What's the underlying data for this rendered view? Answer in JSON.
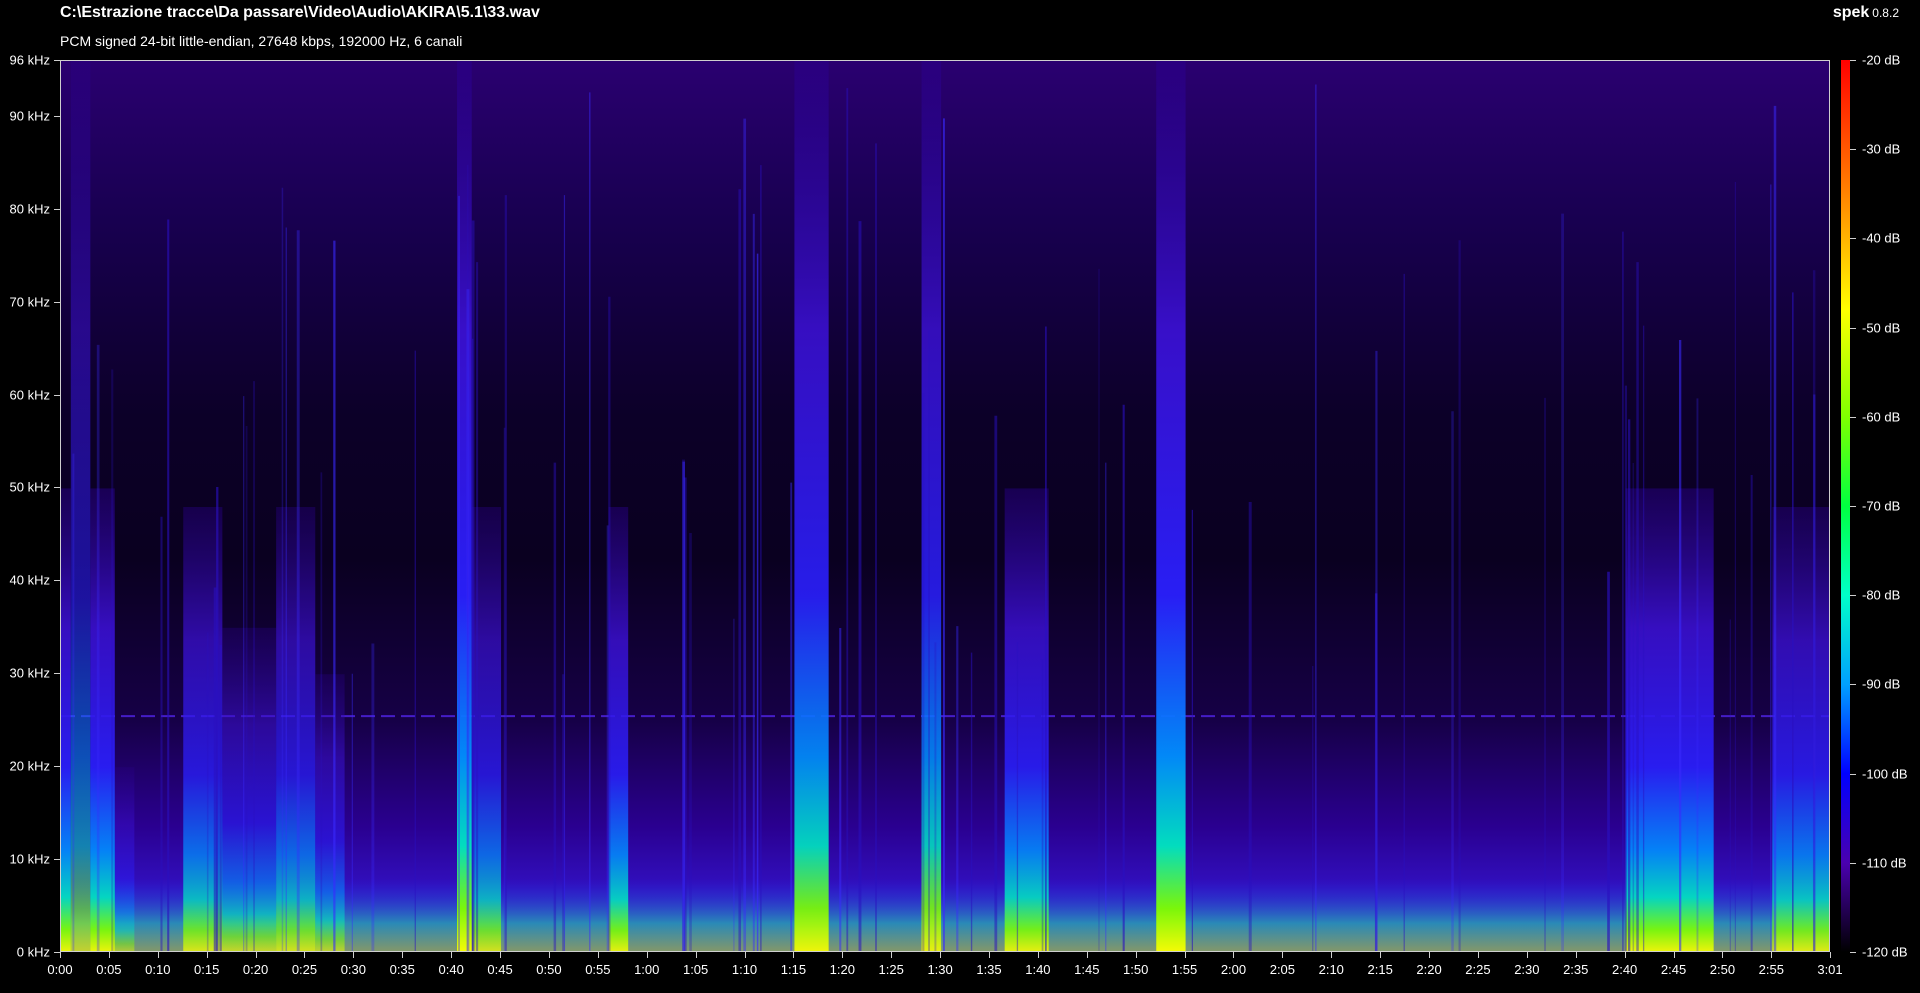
{
  "window": {
    "file_path": "C:\\Estrazione tracce\\Da passare\\Video\\Audio\\AKIRA\\5.1\\33.wav",
    "file_info": "PCM signed 24-bit little-endian, 27648 kbps, 192000 Hz, 6 canali",
    "app_name": "spek",
    "app_version": "0.8.2"
  },
  "frequency_axis": {
    "unit": "kHz",
    "max_label": "96 kHz",
    "labels": [
      "0 kHz",
      "10 kHz",
      "20 kHz",
      "30 kHz",
      "40 kHz",
      "50 kHz",
      "60 kHz",
      "70 kHz",
      "80 kHz",
      "90 kHz",
      "96 kHz"
    ],
    "values": [
      0,
      10,
      20,
      30,
      40,
      50,
      60,
      70,
      80,
      90,
      96
    ]
  },
  "time_axis": {
    "labels": [
      "0:00",
      "0:05",
      "0:10",
      "0:15",
      "0:20",
      "0:25",
      "0:30",
      "0:35",
      "0:40",
      "0:45",
      "0:50",
      "0:55",
      "1:00",
      "1:05",
      "1:10",
      "1:15",
      "1:20",
      "1:25",
      "1:30",
      "1:35",
      "1:40",
      "1:45",
      "1:50",
      "1:55",
      "2:00",
      "2:05",
      "2:10",
      "2:15",
      "2:20",
      "2:25",
      "2:30",
      "2:35",
      "2:40",
      "2:45",
      "2:50",
      "2:55",
      "3:01"
    ],
    "seconds": [
      0,
      5,
      10,
      15,
      20,
      25,
      30,
      35,
      40,
      45,
      50,
      55,
      60,
      65,
      70,
      75,
      80,
      85,
      90,
      95,
      100,
      105,
      110,
      115,
      120,
      125,
      130,
      135,
      140,
      145,
      150,
      155,
      160,
      165,
      170,
      175,
      181
    ],
    "duration_seconds": 181
  },
  "level_scale": {
    "labels": [
      "-20 dB",
      "-30 dB",
      "-40 dB",
      "-50 dB",
      "-60 dB",
      "-70 dB",
      "-80 dB",
      "-90 dB",
      "-100 dB",
      "-110 dB",
      "-120 dB"
    ],
    "values": [
      -20,
      -30,
      -40,
      -50,
      -60,
      -70,
      -80,
      -90,
      -100,
      -110,
      -120
    ],
    "colors": [
      "#ff0000",
      "#ff7a00",
      "#ffff00",
      "#7fff00",
      "#00ff40",
      "#00ffc8",
      "#00a0ff",
      "#0000ff",
      "#4a00b0",
      "#1a0040",
      "#000000"
    ]
  },
  "spectrogram": {
    "background_color": "#0a0020",
    "energy_bursts": [
      {
        "start": 0.0,
        "end": 1.0,
        "top_khz": 50,
        "strength": 0.9
      },
      {
        "start": 1.0,
        "end": 3.0,
        "top_khz": 96,
        "strength": 0.55
      },
      {
        "start": 3.0,
        "end": 5.5,
        "top_khz": 50,
        "strength": 0.9
      },
      {
        "start": 5.5,
        "end": 7.5,
        "top_khz": 20,
        "strength": 0.45
      },
      {
        "start": 12.5,
        "end": 16.5,
        "top_khz": 48,
        "strength": 0.75
      },
      {
        "start": 16.5,
        "end": 22.0,
        "top_khz": 35,
        "strength": 0.6
      },
      {
        "start": 22.0,
        "end": 26.0,
        "top_khz": 48,
        "strength": 0.7
      },
      {
        "start": 26.0,
        "end": 29.0,
        "top_khz": 30,
        "strength": 0.55
      },
      {
        "start": 40.5,
        "end": 42.0,
        "top_khz": 96,
        "strength": 0.95
      },
      {
        "start": 42.0,
        "end": 45.0,
        "top_khz": 48,
        "strength": 0.7
      },
      {
        "start": 56.0,
        "end": 58.0,
        "top_khz": 48,
        "strength": 0.85
      },
      {
        "start": 75.0,
        "end": 78.5,
        "top_khz": 96,
        "strength": 0.9
      },
      {
        "start": 88.0,
        "end": 90.0,
        "top_khz": 96,
        "strength": 0.85
      },
      {
        "start": 96.5,
        "end": 101.0,
        "top_khz": 50,
        "strength": 0.85
      },
      {
        "start": 112.0,
        "end": 115.0,
        "top_khz": 96,
        "strength": 0.95
      },
      {
        "start": 160.0,
        "end": 169.0,
        "top_khz": 50,
        "strength": 0.9
      },
      {
        "start": 175.0,
        "end": 181.0,
        "top_khz": 48,
        "strength": 0.8
      }
    ],
    "horizontal_line_khz": 25.5
  }
}
